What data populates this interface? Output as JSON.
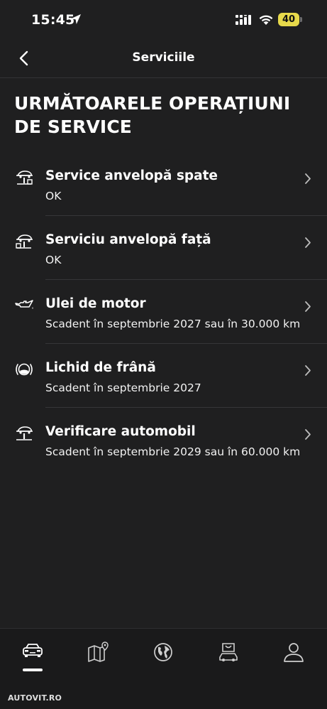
{
  "status_bar": {
    "time": "15:45",
    "battery_level": "40",
    "battery_color": "#e7d94b"
  },
  "header": {
    "title": "Serviciile",
    "back_icon": "chevron-left-icon"
  },
  "main": {
    "heading": "URMĂTOARELE OPERAȚIUNI DE SERVICE",
    "items": [
      {
        "title": "Service anvelopă spate",
        "subtitle": "OK",
        "icon": "car-lift-rear-icon"
      },
      {
        "title": "Serviciu anvelopă față",
        "subtitle": "OK",
        "icon": "car-lift-front-icon"
      },
      {
        "title": "Ulei de motor",
        "subtitle": "Scadent în septembrie 2027 sau în 30.000 km",
        "icon": "oil-can-icon"
      },
      {
        "title": "Lichid de frână",
        "subtitle": "Scadent în septembrie 2027",
        "icon": "brake-fluid-icon"
      },
      {
        "title": "Verificare automobil",
        "subtitle": "Scadent în septembrie 2029 sau în 60.000 km",
        "icon": "vehicle-check-icon"
      }
    ]
  },
  "tab_bar": {
    "tabs": [
      {
        "icon": "car-icon",
        "active": true
      },
      {
        "icon": "map-pin-icon",
        "active": false
      },
      {
        "icon": "globe-icon",
        "active": false
      },
      {
        "icon": "shop-car-icon",
        "active": false
      },
      {
        "icon": "profile-icon",
        "active": false
      }
    ]
  },
  "watermark": "AUTOVIT.RO"
}
